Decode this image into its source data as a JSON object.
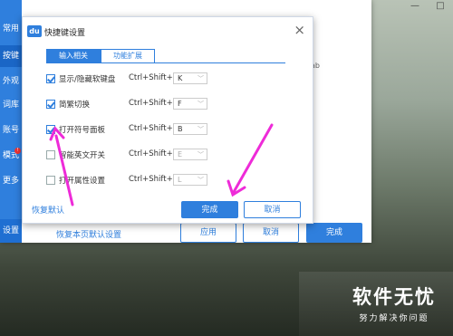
{
  "background_window": {
    "nav_items": [
      "常用",
      "按键",
      "外观",
      "词库",
      "账号",
      "模式",
      "更多"
    ],
    "nav_active_index": 1,
    "nav_badge": "!",
    "nav_bottom": "设置",
    "tab_hint": "ab",
    "reset_link": "恢复本页默认设置",
    "apply_button": "应用",
    "cancel_button": "取消",
    "done_button": "完成"
  },
  "dialog": {
    "logo": "du",
    "title": "快捷键设置",
    "close_icon": "×",
    "tabs": [
      "输入相关",
      "功能扩展"
    ],
    "active_tab": 0,
    "rows": [
      {
        "label": "显示/隐藏软键盘",
        "checked": true,
        "modifier": "Ctrl+Shift+",
        "key": "K",
        "enabled": true
      },
      {
        "label": "简繁切换",
        "checked": true,
        "modifier": "Ctrl+Shift+",
        "key": "F",
        "enabled": true
      },
      {
        "label": "打开符号面板",
        "checked": true,
        "modifier": "Ctrl+Shift+",
        "key": "B",
        "enabled": true
      },
      {
        "label": "智能英文开关",
        "checked": false,
        "modifier": "Ctrl+Shift+",
        "key": "E",
        "enabled": false
      },
      {
        "label": "打开属性设置",
        "checked": false,
        "modifier": "Ctrl+Shift+",
        "key": "L",
        "enabled": false
      }
    ],
    "reset_link": "恢复默认",
    "done_button": "完成",
    "cancel_button": "取消"
  },
  "window_controls": [
    "—",
    "□"
  ],
  "annotation_color": "#ee2bd8",
  "watermark": {
    "main": "软件无忧",
    "sub": "努力解决你问题"
  }
}
